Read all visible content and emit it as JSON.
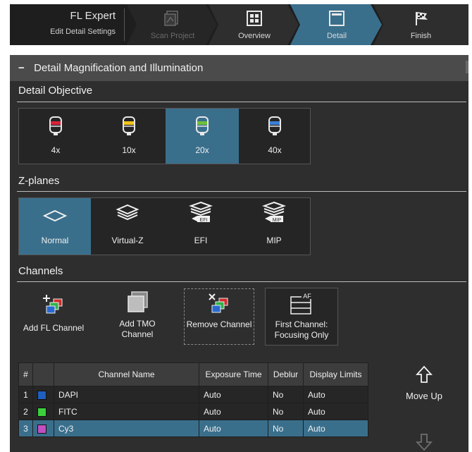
{
  "header": {
    "app_name": "FL Expert",
    "subtitle": "Edit Detail Settings",
    "steps": [
      {
        "label": "Scan Project",
        "icon": "scan-project-icon",
        "state": "disabled"
      },
      {
        "label": "Overview",
        "icon": "overview-grid-icon",
        "state": "normal"
      },
      {
        "label": "Detail",
        "icon": "detail-window-icon",
        "state": "active"
      },
      {
        "label": "Finish",
        "icon": "checkered-flag-icon",
        "state": "normal"
      }
    ]
  },
  "panel": {
    "title": "Detail Magnification and Illumination",
    "collapse_symbol": "−"
  },
  "objective": {
    "title": "Detail Objective",
    "options": [
      {
        "label": "4x",
        "band_color": "#d8213a",
        "selected": false
      },
      {
        "label": "10x",
        "band_color": "#f0c419",
        "selected": false
      },
      {
        "label": "20x",
        "band_color": "#6fbf3a",
        "selected": true
      },
      {
        "label": "40x",
        "band_color": "#3a7fd5",
        "selected": false
      }
    ]
  },
  "zplanes": {
    "title": "Z-planes",
    "options": [
      {
        "label": "Normal",
        "icon": "single-plane-icon",
        "selected": true
      },
      {
        "label": "Virtual-Z",
        "icon": "stacked-planes-icon",
        "selected": false
      },
      {
        "label": "EFI",
        "icon": "efi-stack-icon",
        "badge": "EFI",
        "selected": false
      },
      {
        "label": "MIP",
        "icon": "mip-stack-icon",
        "badge": "MIP",
        "selected": false
      }
    ]
  },
  "channels": {
    "title": "Channels",
    "buttons": {
      "add_fl": "Add FL Channel",
      "add_tmo": "Add TMO Channel",
      "remove": "Remove Channel",
      "first": "First Channel: Focusing Only",
      "first_badge": "AF"
    },
    "columns": [
      "#",
      "",
      "Channel Name",
      "Exposure Time",
      "Deblur",
      "Display Limits"
    ],
    "rows": [
      {
        "num": "1",
        "color": "#1f5fbf",
        "name": "DAPI",
        "exposure": "Auto",
        "deblur": "No",
        "limits": "Auto",
        "selected": false
      },
      {
        "num": "2",
        "color": "#3ccf3c",
        "name": "FITC",
        "exposure": "Auto",
        "deblur": "No",
        "limits": "Auto",
        "selected": false
      },
      {
        "num": "3",
        "color": "#c04fc0",
        "name": "Cy3",
        "exposure": "Auto",
        "deblur": "No",
        "limits": "Auto",
        "selected": true
      }
    ],
    "move_up": "Move Up"
  }
}
